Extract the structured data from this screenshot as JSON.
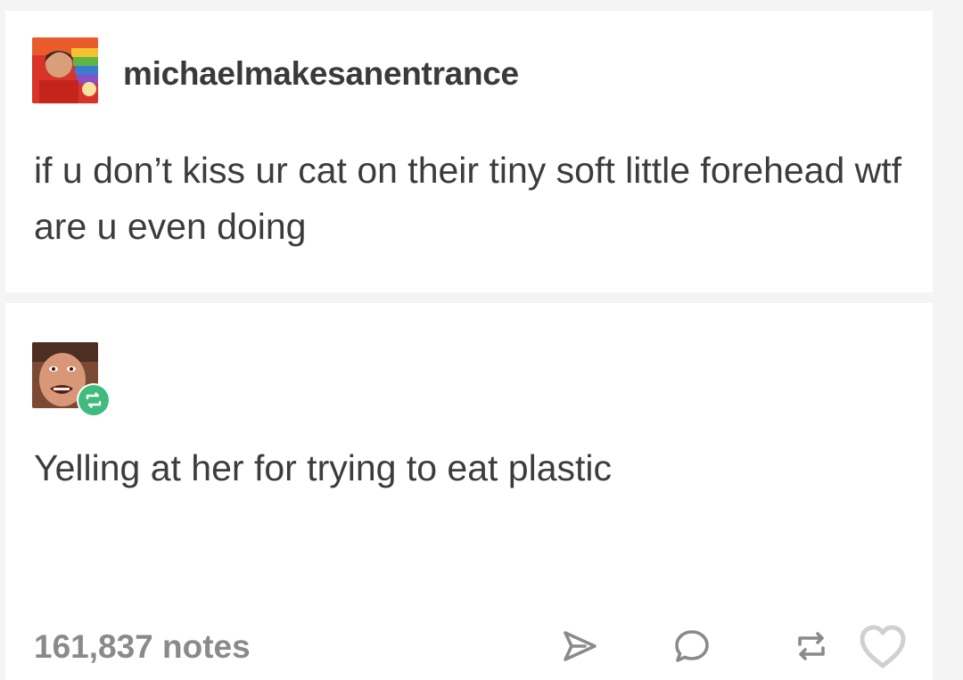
{
  "post": {
    "username": "michaelmakesanentrance",
    "text": "if u don’t kiss ur cat on their tiny soft little forehead wtf are u even doing"
  },
  "reblog": {
    "text": "Yelling at her for trying to eat plastic"
  },
  "footer": {
    "notes": "161,837 notes"
  },
  "icons": {
    "share": "share-icon",
    "reply": "reply-icon",
    "reblog": "reblog-icon",
    "like": "heart-icon",
    "reblog_badge": "reblog-badge-icon"
  },
  "colors": {
    "reblog_green": "#3fbc7d",
    "text": "#3c3c3c",
    "muted": "#8a8a8a"
  }
}
